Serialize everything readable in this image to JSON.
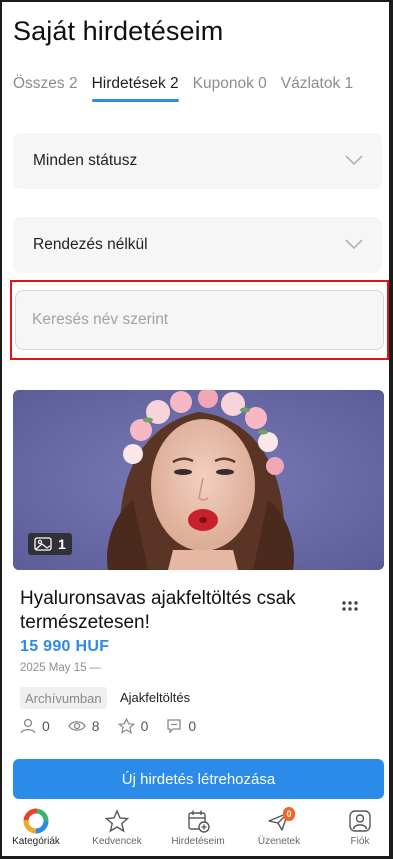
{
  "page": {
    "title": "Saját hirdetéseim"
  },
  "tabs": [
    {
      "label": "Összes 2",
      "active": false
    },
    {
      "label": "Hirdetések 2",
      "active": true
    },
    {
      "label": "Kuponok 0",
      "active": false
    },
    {
      "label": "Vázlatok 1",
      "active": false
    }
  ],
  "filters": {
    "status": {
      "selected": "Minden státusz",
      "icon": "chevron-down-icon"
    },
    "sort": {
      "selected": "Rendezés nélkül",
      "icon": "chevron-down-icon"
    }
  },
  "search": {
    "placeholder": "Keresés név szerint",
    "value": ""
  },
  "ad": {
    "photo_count": "1",
    "title": "Hyaluronsavas ajakfeltöltés csak természetesen!",
    "price": "15 990  HUF",
    "date": "2025 May 15 —",
    "status_badge": "Archívumban",
    "category": "Ajakfeltöltés",
    "stats": {
      "followers": "0",
      "views": "8",
      "favorites": "0",
      "messages": "0"
    }
  },
  "cta": {
    "label": "Új hirdetés létrehozása"
  },
  "bottom_nav": [
    {
      "label": "Kategóriák",
      "icon": "categories-logo-icon",
      "active": true
    },
    {
      "label": "Kedvencek",
      "icon": "star-icon",
      "active": false
    },
    {
      "label": "Hirdetéseim",
      "icon": "calendar-add-icon",
      "active": false
    },
    {
      "label": "Üzenetek",
      "icon": "paper-plane-icon",
      "active": false,
      "badge": "0"
    },
    {
      "label": "Fiók",
      "icon": "user-icon",
      "active": false
    }
  ],
  "colors": {
    "accent": "#2b8be8",
    "highlight": "#e11414",
    "notification": "#f26522"
  }
}
